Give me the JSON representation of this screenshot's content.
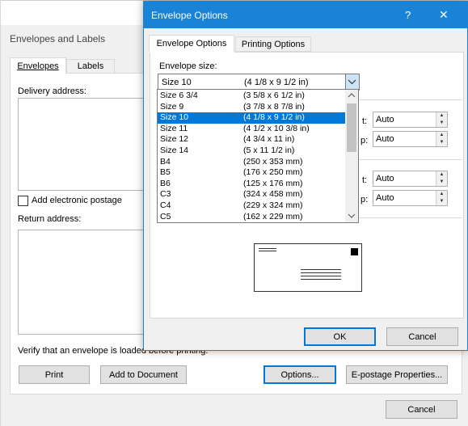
{
  "envelopes_dialog": {
    "title": "Envelopes and Labels",
    "tabs": [
      "Envelopes",
      "Labels"
    ],
    "delivery_label": "Delivery address:",
    "electronic_postage_label": "Add electronic postage",
    "return_label": "Return address:",
    "verify_text": "Verify that an envelope is loaded before printing.",
    "buttons": {
      "print": "Print",
      "add_to_document": "Add to Document",
      "options": "Options...",
      "e_postage": "E-postage Properties...",
      "cancel": "Cancel"
    }
  },
  "options_dialog": {
    "title": "Envelope Options",
    "help_glyph": "?",
    "close_glyph": "✕",
    "tabs": [
      "Envelope Options",
      "Printing Options"
    ],
    "size_label": "Envelope size:",
    "selected_size": {
      "name": "Size 10",
      "dims": "(4 1/8 x 9 1/2 in)"
    },
    "sizes": [
      {
        "name": "Size 6 3/4",
        "dims": "(3 5/8 x 6 1/2 in)"
      },
      {
        "name": "Size 9",
        "dims": "(3 7/8 x 8 7/8 in)"
      },
      {
        "name": "Size 10",
        "dims": "(4 1/8 x 9 1/2 in)"
      },
      {
        "name": "Size 11",
        "dims": "(4 1/2 x 10 3/8 in)"
      },
      {
        "name": "Size 12",
        "dims": "(4 3/4 x 11 in)"
      },
      {
        "name": "Size 14",
        "dims": "(5 x 11 1/2 in)"
      },
      {
        "name": "B4",
        "dims": "(250 x 353 mm)"
      },
      {
        "name": "B5",
        "dims": "(176 x 250 mm)"
      },
      {
        "name": "B6",
        "dims": "(125 x 176 mm)"
      },
      {
        "name": "C3",
        "dims": "(324 x 458 mm)"
      },
      {
        "name": "C4",
        "dims": "(229 x 324 mm)"
      },
      {
        "name": "C5",
        "dims": "(162 x 229 mm)"
      }
    ],
    "selected_index": 2,
    "position_fields": {
      "delivery_from_left": "Auto",
      "delivery_from_top": "Auto",
      "return_from_left": "Auto",
      "return_from_top": "Auto"
    },
    "partial_labels": {
      "a": "t:",
      "b": "p:",
      "c": "t:",
      "d": "p:"
    },
    "buttons": {
      "ok": "OK",
      "cancel": "Cancel"
    },
    "colors": {
      "accent": "#0078d7",
      "title_bar": "#1883d7"
    }
  }
}
